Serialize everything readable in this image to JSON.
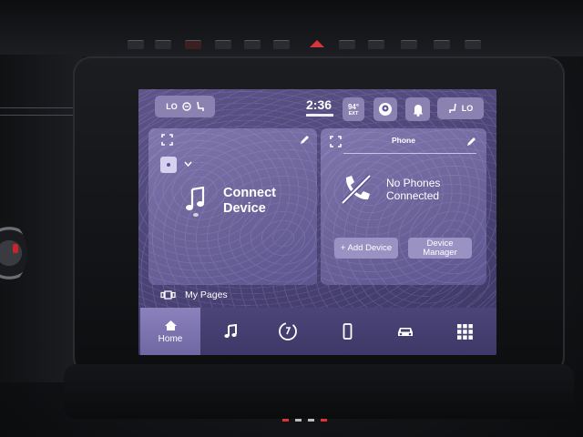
{
  "status_bar": {
    "left_fan_label": "LO",
    "time": "2:36",
    "temperature": "94°",
    "temperature_unit": "EXT",
    "right_fan_label": "LO"
  },
  "cards": {
    "media": {
      "title": "Connect Device"
    },
    "phone": {
      "title": "Phone",
      "status": "No Phones Connected",
      "add_device_label": "+ Add Device",
      "device_manager_label": "Device Manager"
    }
  },
  "my_pages_label": "My Pages",
  "nav": {
    "items": [
      {
        "label": "Home",
        "icon": "home-icon",
        "active": true
      },
      {
        "label": "",
        "icon": "music-note-icon"
      },
      {
        "label": "",
        "icon": "climate-dial-icon"
      },
      {
        "label": "",
        "icon": "smartphone-icon"
      },
      {
        "label": "",
        "icon": "car-icon"
      },
      {
        "label": "",
        "icon": "apps-grid-icon"
      }
    ]
  },
  "colors": {
    "screen_bg": "#4c4477",
    "card_bg": "#6b6399",
    "pill_bg": "#8b82b2",
    "active_nav": "#8b82bd",
    "hazard_red": "#d8343b"
  }
}
